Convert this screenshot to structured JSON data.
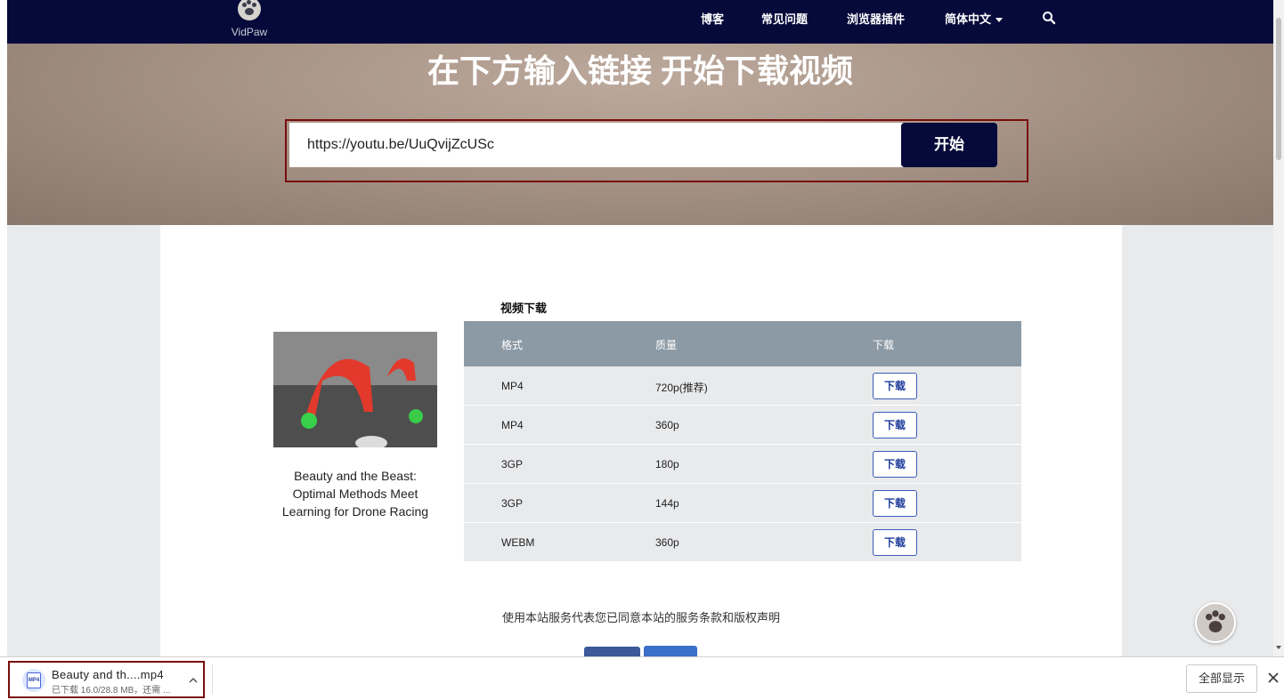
{
  "navbar": {
    "logo_text": "VidPaw",
    "items": [
      {
        "label": "博客"
      },
      {
        "label": "常见问题"
      },
      {
        "label": "浏览器插件"
      },
      {
        "label": "简体中文"
      }
    ],
    "colors": {
      "background": "#050a3a"
    }
  },
  "hero": {
    "title": "在下方输入链接 开始下载视频",
    "input_value": "https://youtu.be/UuQvijZcUSc",
    "start_label": "开始"
  },
  "video": {
    "title": "Beauty and the Beast: Optimal Methods Meet Learning for Drone Racing"
  },
  "downloads": {
    "section_title": "视频下载",
    "headers": [
      "格式",
      "质量",
      "下载"
    ],
    "rows": [
      {
        "format": "MP4",
        "quality": "720p(推荐)",
        "action": "下载"
      },
      {
        "format": "MP4",
        "quality": "360p",
        "action": "下载"
      },
      {
        "format": "3GP",
        "quality": "180p",
        "action": "下载"
      },
      {
        "format": "3GP",
        "quality": "144p",
        "action": "下载"
      },
      {
        "format": "WEBM",
        "quality": "360p",
        "action": "下载"
      }
    ]
  },
  "terms_text": "使用本站服务代表您已同意本站的服务条款和版权声明",
  "download_bar": {
    "file_name": "Beauty and th....mp4",
    "status": "已下载 16.0/28.8 MB，还需 ...",
    "icon_label": "MP4",
    "show_all": "全部显示"
  }
}
